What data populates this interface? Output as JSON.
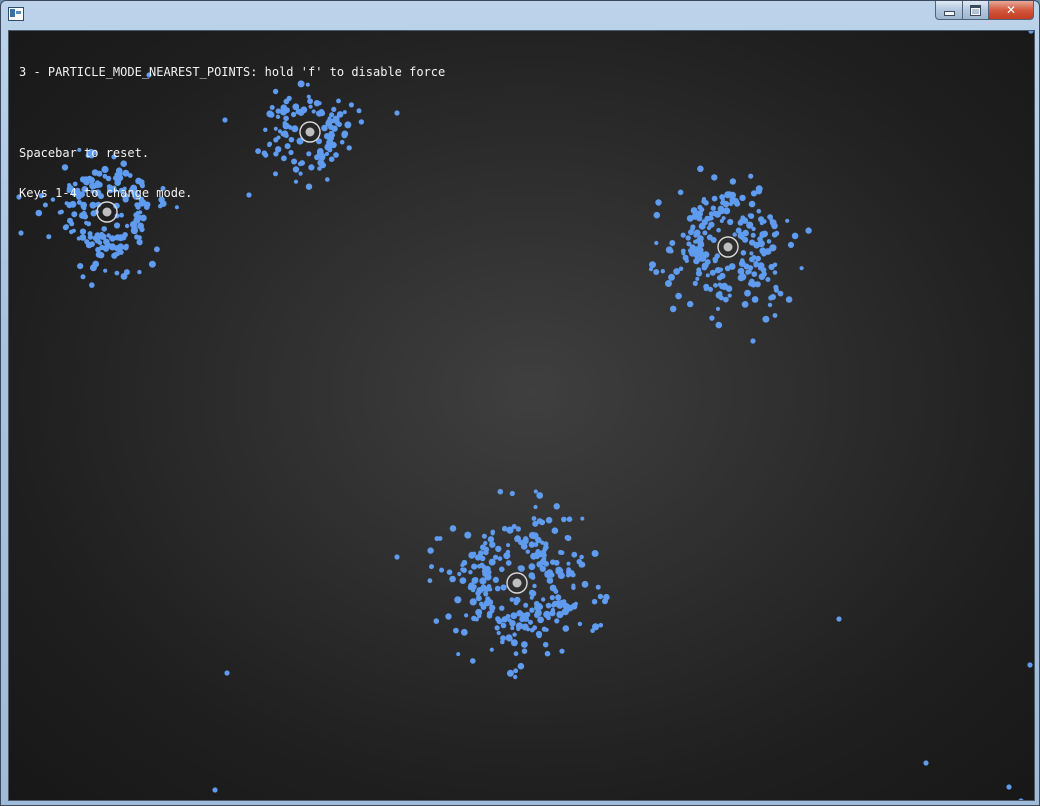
{
  "window": {
    "title": "",
    "caption_buttons": {
      "minimize": "minimize",
      "maximize": "maximize",
      "close": "close"
    }
  },
  "hud": {
    "mode_line": "3 - PARTICLE_MODE_NEAREST_POINTS: hold 'f' to disable force",
    "reset_line": "Spacebar to reset.",
    "mode_keys_line": "Keys 1-4 to change mode."
  },
  "colors": {
    "background_center": "#3f3f3f",
    "background_edge": "#171717",
    "particle": "#5f9bef",
    "attractor_ring": "#d9d9d9",
    "attractor_dot": "#bfbfbf",
    "hud_text": "#f2f2f2"
  },
  "attractor_count": 4
}
